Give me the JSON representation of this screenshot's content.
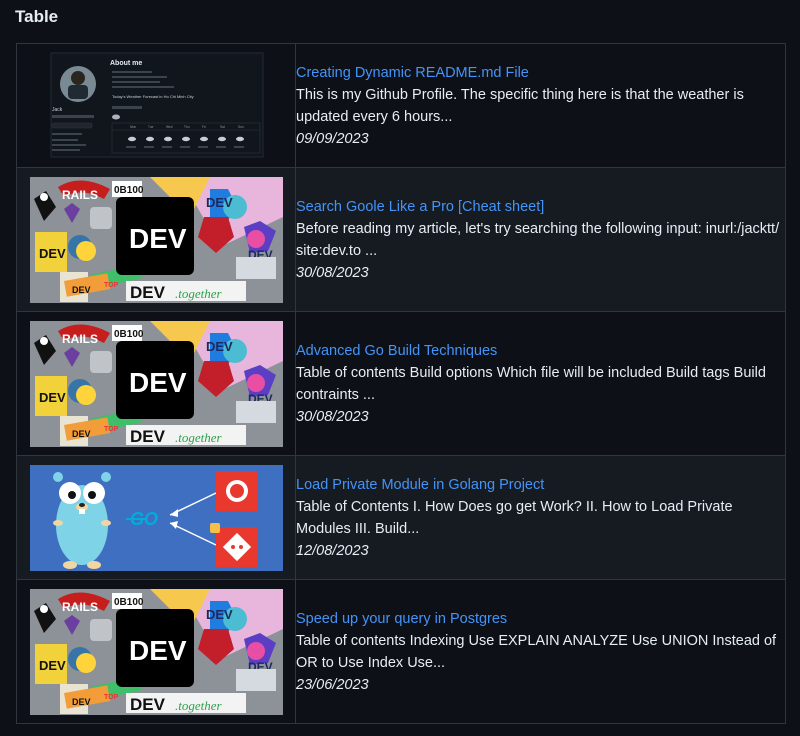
{
  "page": {
    "heading": "Table"
  },
  "rows": [
    {
      "image": "github-profile-screenshot",
      "title": "Creating Dynamic README.md File",
      "description": "This is my Github Profile. The specific thing here is that the weather is updated every 6 hours...",
      "date": "09/09/2023"
    },
    {
      "image": "dev-stickers-cover",
      "title": "Search Goole Like a Pro [Cheat sheet]",
      "description": "Before reading my article, let's try searching the following input: inurl:/jacktt/ site:dev.to ...",
      "date": "30/08/2023"
    },
    {
      "image": "dev-stickers-cover",
      "title": "Advanced Go Build Techniques",
      "description": "Table of contents Build options Which file will be included Build tags Build contraints ...",
      "date": "30/08/2023"
    },
    {
      "image": "go-gopher-private-module",
      "title": "Load Private Module in Golang Project",
      "description": "Table of Contents I. How Does go get Work? II. How to Load Private Modules III. Build...",
      "date": "12/08/2023"
    },
    {
      "image": "dev-stickers-cover",
      "title": "Speed up your query in Postgres",
      "description": "Table of contents Indexing Use EXPLAIN ANALYZE Use UNION Instead of OR to Use Index Use...",
      "date": "23/06/2023"
    }
  ],
  "thumbnails": {
    "github": {
      "header": "About me",
      "user": "Jack",
      "forecast_title": "Today's Weather Forecast in Ho Chi Minh City",
      "days": [
        "Mon",
        "Tue",
        "Wed",
        "Thu",
        "Fri",
        "Sat",
        "Sun"
      ]
    },
    "dev": {
      "logo": "DEV",
      "rails": "RAILS",
      "top": "TOP",
      "together_prefix": "DEV",
      "together_suffix": ".together"
    },
    "go": {
      "go_text": "GO"
    }
  },
  "colors": {
    "background": "#0d1117",
    "row_alt": "#161b22",
    "border": "#30363d",
    "link": "#4493f8",
    "go_background": "#3f6fc1"
  }
}
